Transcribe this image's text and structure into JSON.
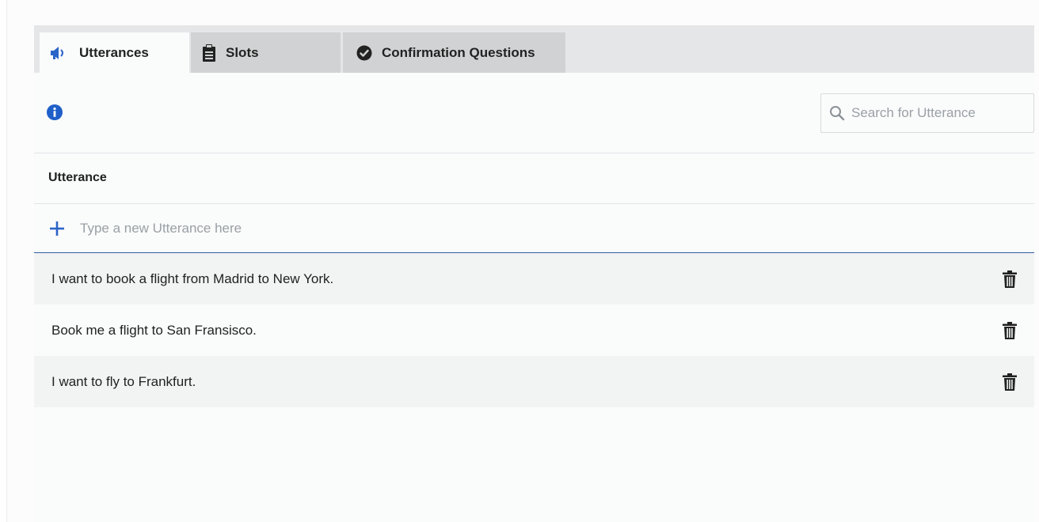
{
  "tabs": [
    {
      "label": "Utterances",
      "icon": "megaphone-icon",
      "active": true
    },
    {
      "label": "Slots",
      "icon": "clipboard-icon",
      "active": false
    },
    {
      "label": "Confirmation Questions",
      "icon": "check-circle-icon",
      "active": false
    }
  ],
  "info": {
    "icon": "info-icon"
  },
  "search": {
    "placeholder": "Search for Utterance",
    "value": "",
    "icon": "search-icon"
  },
  "table": {
    "column_header": "Utterance",
    "new_placeholder": "Type a new Utterance here",
    "new_icon": "plus-icon",
    "rows": [
      {
        "text": "I want to book a flight from Madrid to New York."
      },
      {
        "text": "Book me a flight to San Fransisco."
      },
      {
        "text": "I want to fly to Frankfurt."
      }
    ],
    "row_action_icon": "trash-icon"
  },
  "colors": {
    "accent": "#2b64c8",
    "tab_active_bg": "#fafbfb",
    "tab_inactive_bg": "#d1d2d3",
    "tabbar_bg": "#e5e6e7",
    "input_underline": "#2f5f9e"
  }
}
